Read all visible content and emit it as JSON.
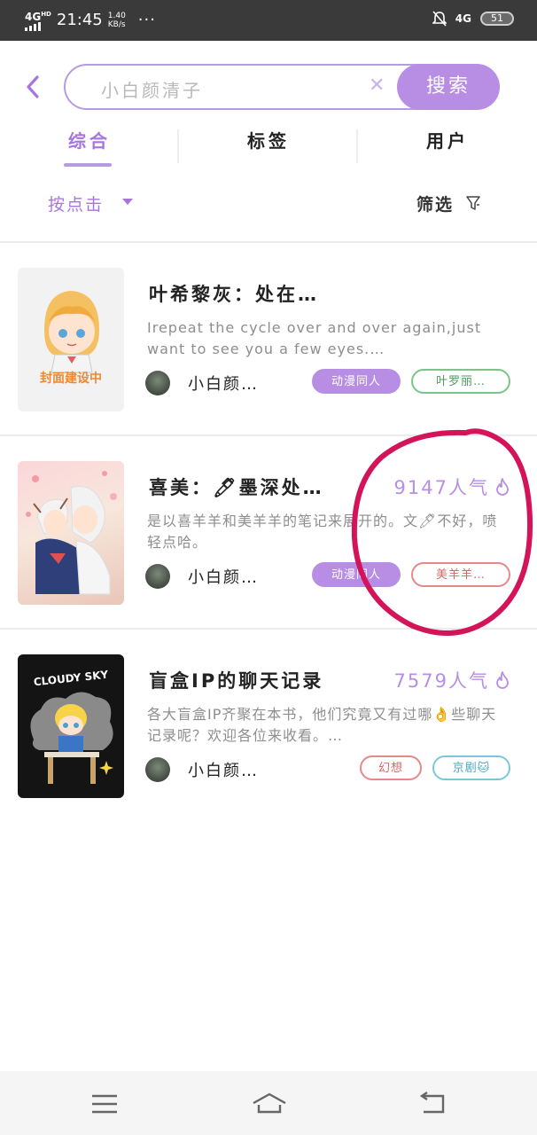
{
  "status_bar": {
    "network": "4G",
    "hd": "HD",
    "time": "21:45",
    "speed_value": "1.40",
    "speed_unit": "KB/s",
    "more": "···",
    "right_network": "4G",
    "battery": "51"
  },
  "search": {
    "query": "小白颜清子",
    "button_label": "搜索"
  },
  "tabs": [
    {
      "label": "综合",
      "active": true
    },
    {
      "label": "标签",
      "active": false
    },
    {
      "label": "用户",
      "active": false
    }
  ],
  "sort": {
    "label": "按点击",
    "filter_label": "筛选"
  },
  "books": [
    {
      "title": "叶希黎灰：处在…",
      "popularity": "",
      "description": "Irepeat the cycle over and over again,just want to see you a few eyes.…",
      "author": "小白颜…",
      "cover_text": "封面建设中",
      "tags": [
        "动漫同人",
        "叶罗丽…"
      ]
    },
    {
      "title": "喜美：🖊墨深处…",
      "popularity": "9147人气",
      "description": "是以喜羊羊和美羊羊的笔记来展开的。文🖊不好，喷轻点哈。",
      "author": "小白颜…",
      "tags": [
        "动漫同人",
        "美羊羊…"
      ]
    },
    {
      "title": "盲盒IP的聊天记录",
      "popularity": "7579人气",
      "description": "各大盲盒IP齐聚在本书，他们究竟又有过哪👌些聊天记录呢？欢迎各位来收看。…",
      "author": "小白颜…",
      "cover_text": "CLOUDY SKY",
      "tags": [
        "幻想",
        "京剧🐱"
      ]
    }
  ],
  "colors": {
    "accent": "#b88ee4",
    "annotation": "#d4145a"
  }
}
